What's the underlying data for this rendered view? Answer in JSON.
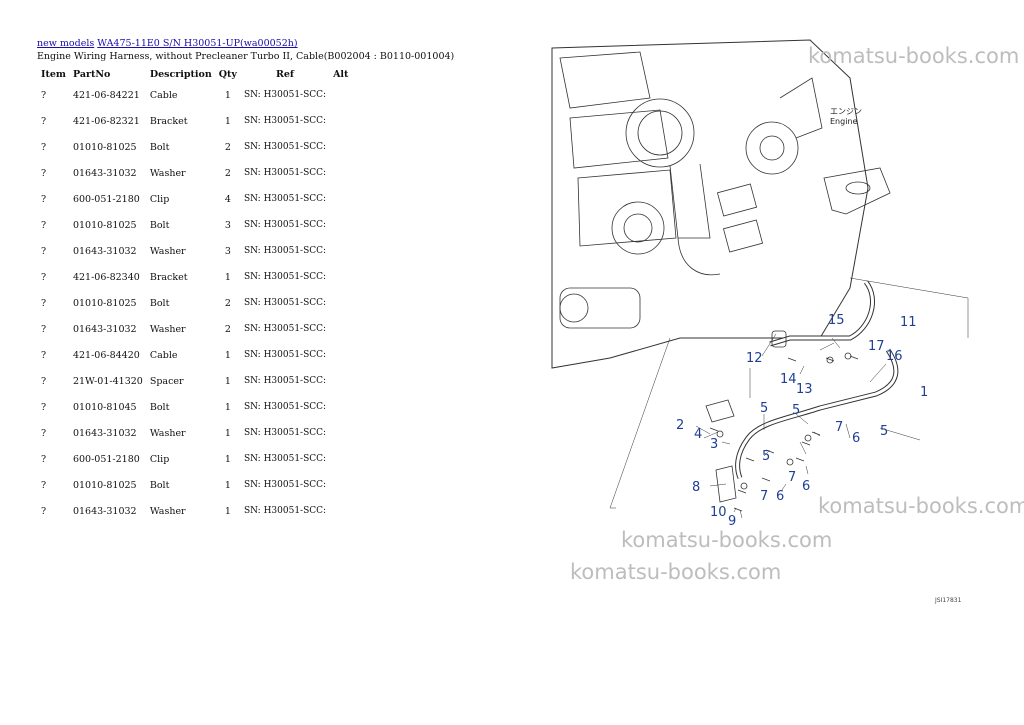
{
  "breadcrumb": {
    "link1": "new models",
    "link2": "WA475-11E0 S/N H30051-UP(wa00052h)"
  },
  "subtitle": "Engine Wiring Harness, without Precleaner Turbo II, Cable(B002004 : B0110-001004)",
  "table": {
    "headers": {
      "item": "Item",
      "partno": "PartNo",
      "description": "Description",
      "qty": "Qty",
      "ref": "Ref",
      "alt": "Alt"
    },
    "rows": [
      {
        "item": "?",
        "partno": "421-06-84221",
        "description": "Cable",
        "qty": "1",
        "ref": "SN: H30051-SCC:"
      },
      {
        "item": "?",
        "partno": "421-06-82321",
        "description": "Bracket",
        "qty": "1",
        "ref": "SN: H30051-SCC:"
      },
      {
        "item": "?",
        "partno": "01010-81025",
        "description": "Bolt",
        "qty": "2",
        "ref": "SN: H30051-SCC:"
      },
      {
        "item": "?",
        "partno": "01643-31032",
        "description": "Washer",
        "qty": "2",
        "ref": "SN: H30051-SCC:"
      },
      {
        "item": "?",
        "partno": "600-051-2180",
        "description": "Clip",
        "qty": "4",
        "ref": "SN: H30051-SCC:"
      },
      {
        "item": "?",
        "partno": "01010-81025",
        "description": "Bolt",
        "qty": "3",
        "ref": "SN: H30051-SCC:"
      },
      {
        "item": "?",
        "partno": "01643-31032",
        "description": "Washer",
        "qty": "3",
        "ref": "SN: H30051-SCC:"
      },
      {
        "item": "?",
        "partno": "421-06-82340",
        "description": "Bracket",
        "qty": "1",
        "ref": "SN: H30051-SCC:"
      },
      {
        "item": "?",
        "partno": "01010-81025",
        "description": "Bolt",
        "qty": "2",
        "ref": "SN: H30051-SCC:"
      },
      {
        "item": "?",
        "partno": "01643-31032",
        "description": "Washer",
        "qty": "2",
        "ref": "SN: H30051-SCC:"
      },
      {
        "item": "?",
        "partno": "421-06-84420",
        "description": "Cable",
        "qty": "1",
        "ref": "SN: H30051-SCC:"
      },
      {
        "item": "?",
        "partno": "21W-01-41320",
        "description": "Spacer",
        "qty": "1",
        "ref": "SN: H30051-SCC:"
      },
      {
        "item": "?",
        "partno": "01010-81045",
        "description": "Bolt",
        "qty": "1",
        "ref": "SN: H30051-SCC:"
      },
      {
        "item": "?",
        "partno": "01643-31032",
        "description": "Washer",
        "qty": "1",
        "ref": "SN: H30051-SCC:"
      },
      {
        "item": "?",
        "partno": "600-051-2180",
        "description": "Clip",
        "qty": "1",
        "ref": "SN: H30051-SCC:"
      },
      {
        "item": "?",
        "partno": "01010-81025",
        "description": "Bolt",
        "qty": "1",
        "ref": "SN: H30051-SCC:"
      },
      {
        "item": "?",
        "partno": "01643-31032",
        "description": "Washer",
        "qty": "1",
        "ref": "SN: H30051-SCC:"
      }
    ]
  },
  "diagram": {
    "engine_label_jp": "エンジン",
    "engine_label_en": "Engine",
    "figure_id": "JSI17831",
    "callouts": [
      "1",
      "2",
      "3",
      "4",
      "5",
      "5",
      "5",
      "5",
      "6",
      "6",
      "6",
      "7",
      "7",
      "7",
      "8",
      "9",
      "10",
      "11",
      "12",
      "13",
      "14",
      "15",
      "16",
      "17"
    ]
  },
  "watermarks": [
    "komatsu-books.com",
    "komatsu-books.com",
    "komatsu-books.com",
    "komatsu-books.com"
  ],
  "colors": {
    "link": "#1a0dab",
    "callout": "#1f3f94",
    "watermark": "#bdbdbd"
  }
}
